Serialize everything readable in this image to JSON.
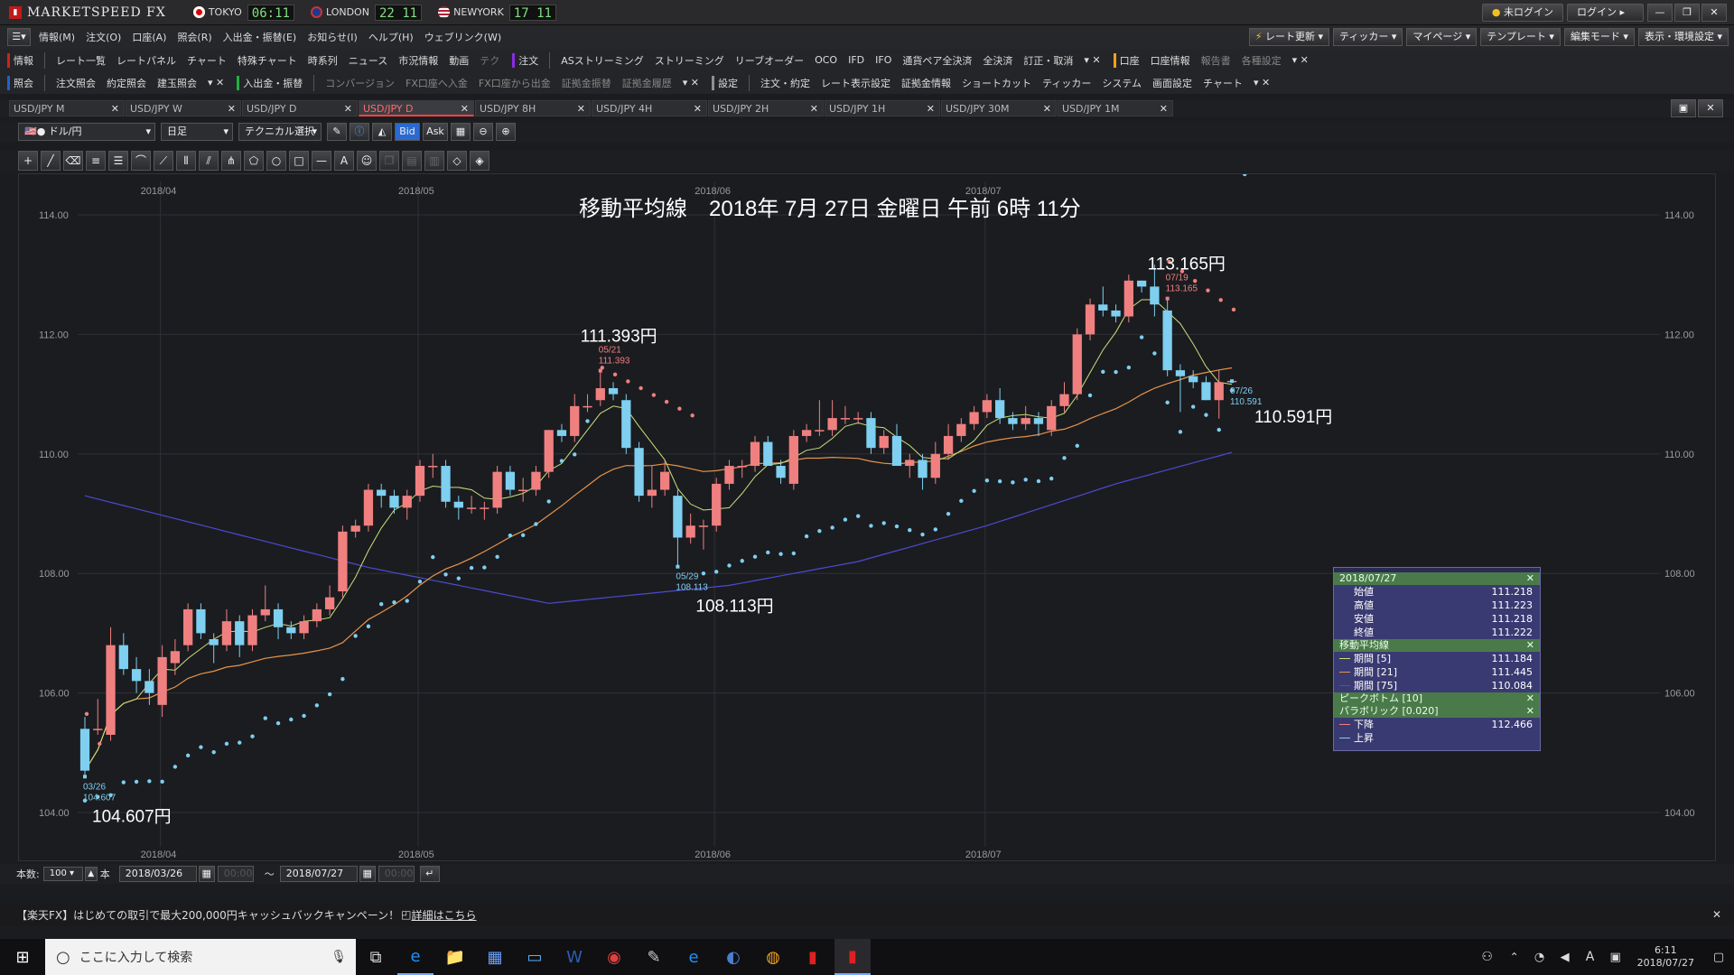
{
  "titlebar": {
    "app_name": "MARKETSPEED FX",
    "clocks": [
      {
        "name": "TOKYO",
        "time": "06:11",
        "color": "#ffffff"
      },
      {
        "name": "LONDON",
        "time": "22 11",
        "color": "#1f3a8a"
      },
      {
        "name": "NEWYORK",
        "time": "17 11",
        "color": "#b22234"
      }
    ],
    "login_status": "未ログイン",
    "login_button": "ログイン"
  },
  "menubar": {
    "items": [
      "情報(M)",
      "注文(O)",
      "口座(A)",
      "照会(R)",
      "入出金・振替(E)",
      "お知らせ(I)",
      "ヘルプ(H)",
      "ウェブリンク(W)"
    ],
    "right_buttons": [
      "レート更新",
      "ティッカー",
      "マイページ",
      "テンプレート",
      "編集モード",
      "表示・環境設定"
    ]
  },
  "toolbar1": {
    "group1_label": "情報",
    "group1_items": [
      "レート一覧",
      "レートパネル",
      "チャート",
      "特殊チャート",
      "時系列",
      "ニュース",
      "市況情報",
      "動画",
      "テク"
    ],
    "group2_label": "注文",
    "group2_items": [
      "ASストリーミング",
      "ストリーミング",
      "リーブオーダー",
      "OCO",
      "IFD",
      "IFO",
      "通貨ペア全決済",
      "全決済",
      "訂正・取消"
    ],
    "group3_label": "口座",
    "group3_items": [
      "口座情報",
      "報告書",
      "各種設定"
    ]
  },
  "toolbar2": {
    "group1_label": "照会",
    "group1_items": [
      "注文照会",
      "約定照会",
      "建玉照会"
    ],
    "group2_label": "入出金・振替",
    "group2_items": [
      "コンバージョン",
      "FX口座へ入金",
      "FX口座から出金",
      "証拠金振替",
      "証拠金履歴"
    ],
    "group3_label": "設定",
    "group3_items": [
      "注文・約定",
      "レート表示設定",
      "証拠金情報",
      "ショートカット",
      "ティッカー",
      "システム",
      "画面設定",
      "チャート"
    ]
  },
  "tabs": [
    {
      "label": "USD/JPY M",
      "active": false
    },
    {
      "label": "USD/JPY W",
      "active": false
    },
    {
      "label": "USD/JPY D",
      "active": false
    },
    {
      "label": "USD/JPY D",
      "active": true
    },
    {
      "label": "USD/JPY 8H",
      "active": false
    },
    {
      "label": "USD/JPY 4H",
      "active": false
    },
    {
      "label": "USD/JPY 2H",
      "active": false
    },
    {
      "label": "USD/JPY 1H",
      "active": false
    },
    {
      "label": "USD/JPY 30M",
      "active": false
    },
    {
      "label": "USD/JPY 1M",
      "active": false
    }
  ],
  "chart_toolbar": {
    "pair": "ドル/円",
    "period": "日足",
    "technical": "テクニカル選択",
    "bid": "Bid",
    "ask": "Ask"
  },
  "chart_data": {
    "type": "candlestick",
    "title": "移動平均線　2018年 7月 27日 金曜日 午前 6時 11分",
    "ylim": [
      104,
      114
    ],
    "y_ticks": [
      "114.00",
      "112.00",
      "110.00",
      "108.00",
      "106.00",
      "104.00"
    ],
    "month_labels": [
      "2018/04",
      "2018/05",
      "2018/06",
      "2018/07"
    ],
    "candles": [
      {
        "date": "2018/03/26",
        "o": 105.4,
        "h": 105.6,
        "l": 104.6,
        "c": 104.7
      },
      {
        "date": "2018/03/27",
        "o": 105.4,
        "h": 105.9,
        "l": 105.3,
        "c": 105.4
      },
      {
        "date": "2018/03/28",
        "o": 105.3,
        "h": 107.1,
        "l": 105.2,
        "c": 106.8
      },
      {
        "date": "2018/03/29",
        "o": 106.8,
        "h": 107.0,
        "l": 106.3,
        "c": 106.4
      },
      {
        "date": "2018/03/30",
        "o": 106.4,
        "h": 106.6,
        "l": 106.0,
        "c": 106.2
      },
      {
        "date": "2018/04/02",
        "o": 106.2,
        "h": 106.4,
        "l": 105.8,
        "c": 106.0
      },
      {
        "date": "2018/04/03",
        "o": 105.8,
        "h": 106.8,
        "l": 105.6,
        "c": 106.6
      },
      {
        "date": "2018/04/04",
        "o": 106.5,
        "h": 106.9,
        "l": 106.3,
        "c": 106.7
      },
      {
        "date": "2018/04/05",
        "o": 106.8,
        "h": 107.5,
        "l": 106.7,
        "c": 107.4
      },
      {
        "date": "2018/04/06",
        "o": 107.4,
        "h": 107.5,
        "l": 106.9,
        "c": 107.0
      },
      {
        "date": "2018/04/09",
        "o": 106.9,
        "h": 107.0,
        "l": 106.5,
        "c": 106.8
      },
      {
        "date": "2018/04/10",
        "o": 106.8,
        "h": 107.4,
        "l": 106.7,
        "c": 107.2
      },
      {
        "date": "2018/04/11",
        "o": 107.2,
        "h": 107.3,
        "l": 106.6,
        "c": 106.8
      },
      {
        "date": "2018/04/12",
        "o": 106.8,
        "h": 107.4,
        "l": 106.7,
        "c": 107.3
      },
      {
        "date": "2018/04/13",
        "o": 107.3,
        "h": 107.8,
        "l": 107.2,
        "c": 107.4
      },
      {
        "date": "2018/04/16",
        "o": 107.4,
        "h": 107.5,
        "l": 106.9,
        "c": 107.1
      },
      {
        "date": "2018/04/17",
        "o": 107.1,
        "h": 107.2,
        "l": 106.9,
        "c": 107.0
      },
      {
        "date": "2018/04/18",
        "o": 107.0,
        "h": 107.3,
        "l": 106.9,
        "c": 107.2
      },
      {
        "date": "2018/04/19",
        "o": 107.2,
        "h": 107.5,
        "l": 107.1,
        "c": 107.4
      },
      {
        "date": "2018/04/20",
        "o": 107.4,
        "h": 107.8,
        "l": 107.3,
        "c": 107.6
      },
      {
        "date": "2018/04/23",
        "o": 107.7,
        "h": 108.8,
        "l": 107.6,
        "c": 108.7
      },
      {
        "date": "2018/04/24",
        "o": 108.7,
        "h": 108.9,
        "l": 108.6,
        "c": 108.8
      },
      {
        "date": "2018/04/25",
        "o": 108.8,
        "h": 109.5,
        "l": 108.7,
        "c": 109.4
      },
      {
        "date": "2018/04/26",
        "o": 109.4,
        "h": 109.5,
        "l": 109.1,
        "c": 109.3
      },
      {
        "date": "2018/04/27",
        "o": 109.3,
        "h": 109.4,
        "l": 109.0,
        "c": 109.1
      },
      {
        "date": "2018/04/30",
        "o": 109.1,
        "h": 109.4,
        "l": 108.9,
        "c": 109.3
      },
      {
        "date": "2018/05/01",
        "o": 109.3,
        "h": 109.9,
        "l": 109.2,
        "c": 109.8
      },
      {
        "date": "2018/05/02",
        "o": 109.8,
        "h": 110.0,
        "l": 109.6,
        "c": 109.8
      },
      {
        "date": "2018/05/03",
        "o": 109.8,
        "h": 109.9,
        "l": 109.1,
        "c": 109.2
      },
      {
        "date": "2018/05/04",
        "o": 109.2,
        "h": 109.3,
        "l": 108.9,
        "c": 109.1
      },
      {
        "date": "2018/05/07",
        "o": 109.1,
        "h": 109.3,
        "l": 109.0,
        "c": 109.1
      },
      {
        "date": "2018/05/08",
        "o": 109.1,
        "h": 109.2,
        "l": 108.9,
        "c": 109.1
      },
      {
        "date": "2018/05/09",
        "o": 109.1,
        "h": 109.8,
        "l": 109.0,
        "c": 109.7
      },
      {
        "date": "2018/05/10",
        "o": 109.7,
        "h": 109.8,
        "l": 109.3,
        "c": 109.4
      },
      {
        "date": "2018/05/11",
        "o": 109.4,
        "h": 109.6,
        "l": 109.2,
        "c": 109.4
      },
      {
        "date": "2018/05/14",
        "o": 109.4,
        "h": 109.8,
        "l": 109.3,
        "c": 109.7
      },
      {
        "date": "2018/05/15",
        "o": 109.7,
        "h": 110.4,
        "l": 109.6,
        "c": 110.4
      },
      {
        "date": "2018/05/16",
        "o": 110.4,
        "h": 110.5,
        "l": 110.2,
        "c": 110.3
      },
      {
        "date": "2018/05/17",
        "o": 110.3,
        "h": 111.0,
        "l": 110.2,
        "c": 110.8
      },
      {
        "date": "2018/05/18",
        "o": 110.8,
        "h": 111.0,
        "l": 110.7,
        "c": 110.8
      },
      {
        "date": "2018/05/21",
        "o": 110.9,
        "h": 111.393,
        "l": 110.8,
        "c": 111.1
      },
      {
        "date": "2018/05/22",
        "o": 111.1,
        "h": 111.2,
        "l": 110.9,
        "c": 111.0
      },
      {
        "date": "2018/05/23",
        "o": 110.9,
        "h": 111.0,
        "l": 110.0,
        "c": 110.1
      },
      {
        "date": "2018/05/24",
        "o": 110.1,
        "h": 110.2,
        "l": 109.2,
        "c": 109.3
      },
      {
        "date": "2018/05/25",
        "o": 109.3,
        "h": 109.8,
        "l": 109.1,
        "c": 109.4
      },
      {
        "date": "2018/05/28",
        "o": 109.4,
        "h": 109.9,
        "l": 109.3,
        "c": 109.7
      },
      {
        "date": "2018/05/29",
        "o": 109.3,
        "h": 109.4,
        "l": 108.113,
        "c": 108.6
      },
      {
        "date": "2018/05/30",
        "o": 108.6,
        "h": 109.0,
        "l": 108.5,
        "c": 108.8
      },
      {
        "date": "2018/05/31",
        "o": 108.8,
        "h": 108.9,
        "l": 108.4,
        "c": 108.8
      },
      {
        "date": "2018/06/01",
        "o": 108.8,
        "h": 109.6,
        "l": 108.7,
        "c": 109.5
      },
      {
        "date": "2018/06/04",
        "o": 109.5,
        "h": 109.9,
        "l": 109.4,
        "c": 109.8
      },
      {
        "date": "2018/06/05",
        "o": 109.8,
        "h": 109.9,
        "l": 109.6,
        "c": 109.8
      },
      {
        "date": "2018/06/06",
        "o": 109.8,
        "h": 110.3,
        "l": 109.7,
        "c": 110.2
      },
      {
        "date": "2018/06/07",
        "o": 110.2,
        "h": 110.3,
        "l": 109.8,
        "c": 109.8
      },
      {
        "date": "2018/06/08",
        "o": 109.8,
        "h": 109.9,
        "l": 109.5,
        "c": 109.6
      },
      {
        "date": "2018/06/11",
        "o": 109.5,
        "h": 110.4,
        "l": 109.4,
        "c": 110.3
      },
      {
        "date": "2018/06/12",
        "o": 110.3,
        "h": 110.5,
        "l": 110.2,
        "c": 110.4
      },
      {
        "date": "2018/06/13",
        "o": 110.4,
        "h": 110.9,
        "l": 110.3,
        "c": 110.4
      },
      {
        "date": "2018/06/14",
        "o": 110.4,
        "h": 110.9,
        "l": 110.3,
        "c": 110.6
      },
      {
        "date": "2018/06/15",
        "o": 110.6,
        "h": 110.8,
        "l": 110.5,
        "c": 110.6
      },
      {
        "date": "2018/06/18",
        "o": 110.6,
        "h": 110.7,
        "l": 110.5,
        "c": 110.6
      },
      {
        "date": "2018/06/19",
        "o": 110.6,
        "h": 110.7,
        "l": 110.0,
        "c": 110.1
      },
      {
        "date": "2018/06/20",
        "o": 110.1,
        "h": 110.4,
        "l": 110.0,
        "c": 110.3
      },
      {
        "date": "2018/06/21",
        "o": 110.3,
        "h": 110.5,
        "l": 109.8,
        "c": 109.8
      },
      {
        "date": "2018/06/22",
        "o": 109.8,
        "h": 110.0,
        "l": 109.6,
        "c": 109.9
      },
      {
        "date": "2018/06/25",
        "o": 109.9,
        "h": 110.0,
        "l": 109.4,
        "c": 109.6
      },
      {
        "date": "2018/06/26",
        "o": 109.6,
        "h": 110.2,
        "l": 109.5,
        "c": 110.0
      },
      {
        "date": "2018/06/27",
        "o": 110.0,
        "h": 110.5,
        "l": 109.9,
        "c": 110.3
      },
      {
        "date": "2018/06/28",
        "o": 110.3,
        "h": 110.6,
        "l": 110.2,
        "c": 110.5
      },
      {
        "date": "2018/06/29",
        "o": 110.5,
        "h": 110.8,
        "l": 110.4,
        "c": 110.7
      },
      {
        "date": "2018/07/02",
        "o": 110.7,
        "h": 111.0,
        "l": 110.6,
        "c": 110.9
      },
      {
        "date": "2018/07/03",
        "o": 110.9,
        "h": 111.1,
        "l": 110.5,
        "c": 110.6
      },
      {
        "date": "2018/07/04",
        "o": 110.6,
        "h": 110.7,
        "l": 110.4,
        "c": 110.5
      },
      {
        "date": "2018/07/05",
        "o": 110.5,
        "h": 110.8,
        "l": 110.4,
        "c": 110.6
      },
      {
        "date": "2018/07/06",
        "o": 110.6,
        "h": 110.7,
        "l": 110.3,
        "c": 110.5
      },
      {
        "date": "2018/07/09",
        "o": 110.4,
        "h": 110.9,
        "l": 110.3,
        "c": 110.8
      },
      {
        "date": "2018/07/10",
        "o": 110.8,
        "h": 111.2,
        "l": 110.7,
        "c": 111.0
      },
      {
        "date": "2018/07/11",
        "o": 111.0,
        "h": 112.1,
        "l": 110.9,
        "c": 112.0
      },
      {
        "date": "2018/07/12",
        "o": 112.0,
        "h": 112.6,
        "l": 111.9,
        "c": 112.5
      },
      {
        "date": "2018/07/13",
        "o": 112.5,
        "h": 112.8,
        "l": 112.3,
        "c": 112.4
      },
      {
        "date": "2018/07/16",
        "o": 112.4,
        "h": 112.5,
        "l": 112.2,
        "c": 112.3
      },
      {
        "date": "2018/07/17",
        "o": 112.3,
        "h": 113.0,
        "l": 112.2,
        "c": 112.9
      },
      {
        "date": "2018/07/18",
        "o": 112.9,
        "h": 112.9,
        "l": 112.7,
        "c": 112.8
      },
      {
        "date": "2018/07/19",
        "o": 112.8,
        "h": 113.165,
        "l": 112.3,
        "c": 112.5
      },
      {
        "date": "2018/07/20",
        "o": 112.4,
        "h": 112.6,
        "l": 111.3,
        "c": 111.4
      },
      {
        "date": "2018/07/23",
        "o": 111.4,
        "h": 111.5,
        "l": 110.7,
        "c": 111.3
      },
      {
        "date": "2018/07/24",
        "o": 111.3,
        "h": 111.4,
        "l": 111.1,
        "c": 111.2
      },
      {
        "date": "2018/07/25",
        "o": 111.2,
        "h": 111.3,
        "l": 110.9,
        "c": 110.9
      },
      {
        "date": "2018/07/26",
        "o": 110.9,
        "h": 111.4,
        "l": 110.591,
        "c": 111.2
      },
      {
        "date": "2018/07/27",
        "o": 111.218,
        "h": 111.223,
        "l": 111.218,
        "c": 111.222
      }
    ],
    "ma_long_75": {
      "anchors": [
        [
          0,
          109.3
        ],
        [
          22,
          108.1
        ],
        [
          36,
          107.5
        ],
        [
          50,
          107.8
        ],
        [
          60,
          108.2
        ],
        [
          70,
          108.8
        ],
        [
          80,
          109.5
        ],
        [
          90,
          110.084
        ]
      ]
    },
    "parabolic_up_ranges": [
      [
        0,
        39
      ],
      [
        48,
        90
      ]
    ],
    "parabolic_down_ranges": [
      [
        0,
        1
      ],
      [
        40,
        47
      ],
      [
        84,
        89
      ]
    ],
    "annotations": [
      {
        "label": "104.607円",
        "date": "03/26",
        "value": "104.607",
        "kind": "low",
        "index": 0
      },
      {
        "label": "111.393円",
        "date": "05/21",
        "value": "111.393",
        "kind": "high",
        "index": 40
      },
      {
        "label": "108.113円",
        "date": "05/29",
        "value": "108.113",
        "kind": "low",
        "index": 46
      },
      {
        "label": "113.165円",
        "date": "07/19",
        "value": "113.165",
        "kind": "high",
        "index": 84
      },
      {
        "label": "110.591円",
        "date": "07/26",
        "value": "110.591",
        "kind": "low",
        "index": 89
      }
    ],
    "colors": {
      "up": "#f08080",
      "down": "#7ecff0",
      "ma5": "#c8e07a",
      "ma21": "#e6944a",
      "ma75": "#4b4bd0",
      "sar_up": "#7ecff0",
      "sar_down": "#f08080",
      "bg": "#1b1c20",
      "grid": "#2e3036"
    }
  },
  "info_panel": {
    "date": "2018/07/27",
    "ohlc": [
      {
        "label": "始値",
        "value": "111.218"
      },
      {
        "label": "高値",
        "value": "111.223"
      },
      {
        "label": "安値",
        "value": "111.218"
      },
      {
        "label": "終値",
        "value": "111.222"
      }
    ],
    "ma_title": "移動平均線",
    "ma": [
      {
        "label": "期間 [5]",
        "value": "111.184",
        "color": "#c8e07a"
      },
      {
        "label": "期間 [21]",
        "value": "111.445",
        "color": "#e6944a"
      },
      {
        "label": "期間 [75]",
        "value": "110.084",
        "color": "#4b4bd0"
      }
    ],
    "peak_title": "ピークボトム [10]",
    "sar_title": "パラボリック [0.020]",
    "sar": [
      {
        "label": "下降",
        "value": "112.466",
        "color": "#f08080"
      },
      {
        "label": "上昇",
        "value": "",
        "color": "#7ecff0"
      }
    ]
  },
  "bottom_bar": {
    "count_label": "本数:",
    "count_value": "100",
    "unit": "本",
    "from_date": "2018/03/26",
    "from_time": "00:00",
    "tilde": "～",
    "to_date": "2018/07/27",
    "to_time": "00:00"
  },
  "news": {
    "text": "【楽天FX】はじめての取引で最大200,000円キャッシュバックキャンペーン！",
    "link": "詳細はこちら"
  },
  "taskbar": {
    "search_placeholder": "ここに入力して検索",
    "time": "6:11",
    "date": "2018/07/27",
    "ime": "A"
  }
}
